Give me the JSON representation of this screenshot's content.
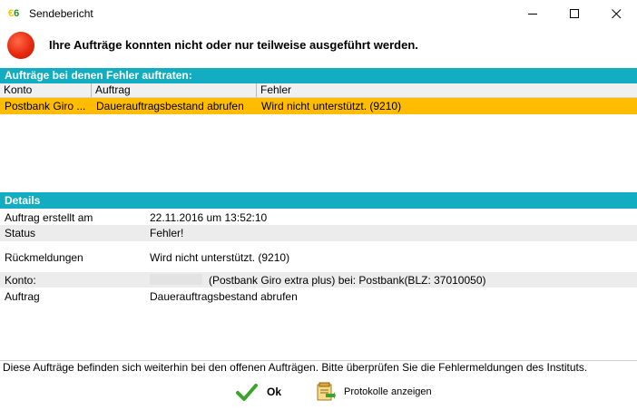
{
  "window": {
    "app_icon": "€6",
    "title": "Sendebericht",
    "controls": {
      "minimize": "minimize-icon",
      "maximize": "maximize-icon",
      "close": "close-icon"
    }
  },
  "header": {
    "status_icon": "red-error-circle-icon",
    "message": "Ihre Aufträge konnten nicht oder nur teilweise ausgeführt werden."
  },
  "errors_section": {
    "title": "Aufträge bei denen Fehler auftraten:",
    "columns": [
      "Konto",
      "Auftrag",
      "Fehler"
    ],
    "rows": [
      {
        "konto": "Postbank Giro ...",
        "auftrag": "Dauerauftragsbestand abrufen",
        "fehler": "Wird nicht unterstützt. (9210)"
      }
    ]
  },
  "details": {
    "title": "Details",
    "fields": [
      {
        "label": "Auftrag erstellt am",
        "value": "22.11.2016 um 13:52:10"
      },
      {
        "label": "Status",
        "value": "Fehler!"
      },
      {
        "label": "Rückmeldungen",
        "value": "Wird nicht unterstützt. (9210)"
      },
      {
        "label": "Konto:",
        "value": "(Postbank Giro extra plus) bei: Postbank(BLZ: 37010050)"
      },
      {
        "label": "Auftrag",
        "value": "Dauerauftragsbestand abrufen"
      }
    ]
  },
  "footer": {
    "note": "Diese Aufträge befinden sich weiterhin bei den offenen Aufträgen. Bitte überprüfen Sie die Fehlermeldungen des Instituts.",
    "ok_label": "Ok",
    "protocol_label": "Protokolle anzeigen"
  },
  "colors": {
    "section_header": "#12adc1",
    "selected_row": "#ffbc00",
    "error_red": "#e62a10"
  }
}
